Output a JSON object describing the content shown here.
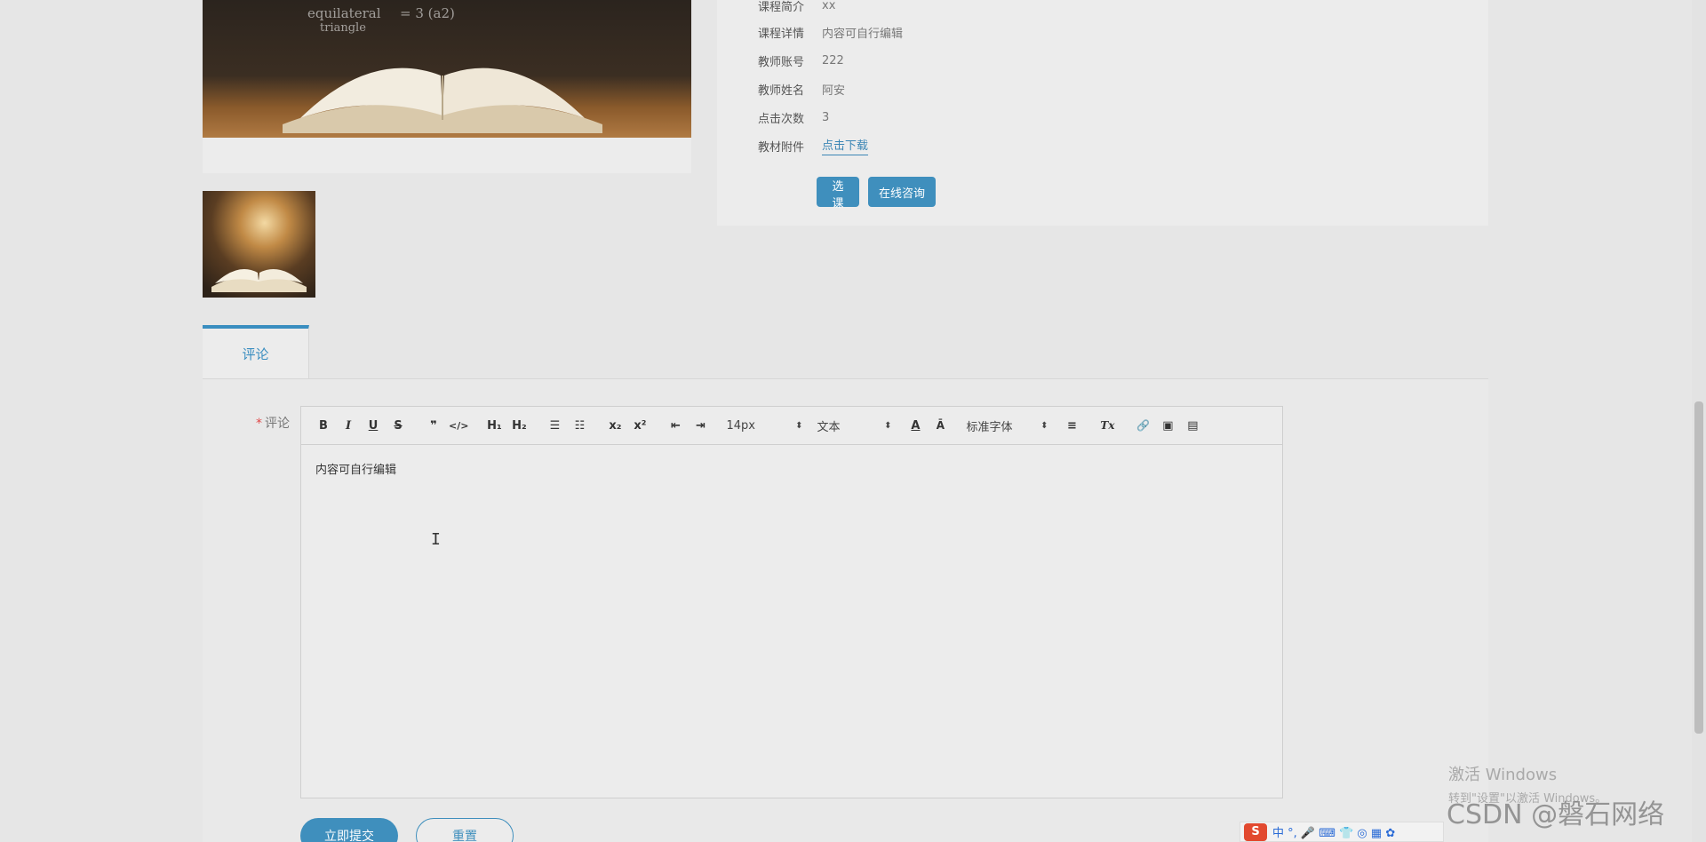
{
  "course_info": {
    "rows": [
      {
        "label": "课程简介",
        "value": "xx"
      },
      {
        "label": "课程详情",
        "value": "内容可自行编辑"
      },
      {
        "label": "教师账号",
        "value": "222"
      },
      {
        "label": "教师姓名",
        "value": "阿安"
      },
      {
        "label": "点击次数",
        "value": "3"
      },
      {
        "label": "教材附件",
        "value": "点击下载"
      }
    ],
    "btn_select": "选课",
    "btn_consult": "在线咨询"
  },
  "images": {
    "board_text_1": "equilateral",
    "board_text_2": "triangle",
    "board_text_3": "= 3 (a2)"
  },
  "tabs": {
    "active": "评论"
  },
  "form": {
    "required_mark": "*",
    "label": "评论",
    "editor_content": "内容可自行编辑",
    "submit": "立即提交",
    "reset": "重置"
  },
  "toolbar": {
    "bold": "B",
    "italic": "I",
    "underline": "U",
    "strike": "S",
    "quote": "❞",
    "code": "</>",
    "h1": "H₁",
    "h2": "H₂",
    "ordered_list": "☰",
    "bullet_list": "☷",
    "sub": "x₂",
    "sup": "x²",
    "outdent": "⇤",
    "indent": "⇥",
    "font_size": "14px",
    "header": "文本",
    "font_family": "标准字体",
    "color": "A",
    "background": "Ā",
    "align": "≡",
    "clean": "Tx",
    "link": "🔗",
    "image": "▣",
    "video": "▤"
  },
  "watermark": {
    "activate_1": "激活 Windows",
    "activate_2": "转到\"设置\"以激活 Windows。",
    "csdn": "CSDN @磐石网络"
  },
  "ime": {
    "logo": "S",
    "items": "中 °, 🎤 ⌨ 👕 ◎ ▦ ✿"
  }
}
